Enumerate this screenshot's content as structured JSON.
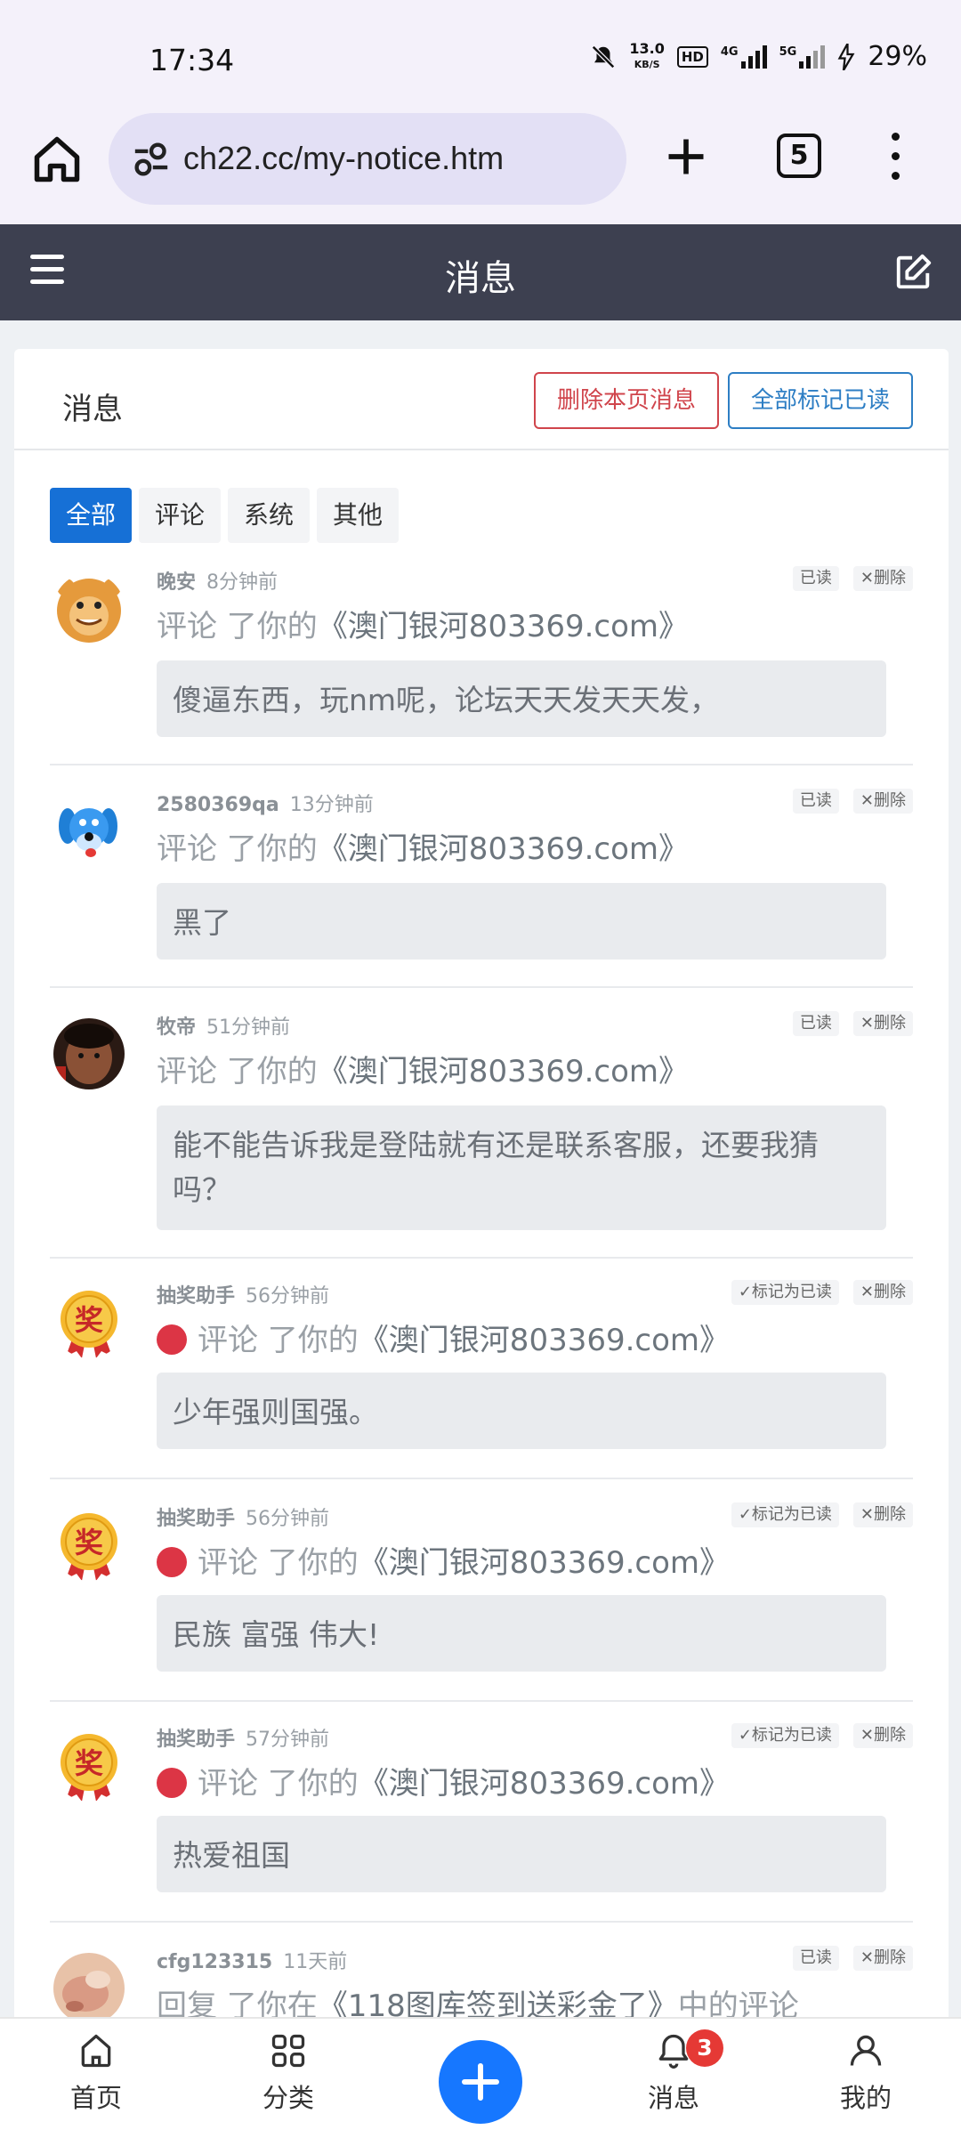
{
  "status_bar": {
    "time": "17:34",
    "net_speed_value": "13.0",
    "net_speed_unit": "KB/S",
    "hd": "HD",
    "sim1": "4G",
    "sim2": "5G",
    "battery": "29%"
  },
  "browser": {
    "url": "ch22.cc/my-notice.htm",
    "tab_count": "5"
  },
  "header": {
    "title": "消息"
  },
  "card": {
    "title": "消息",
    "delete_page_label": "删除本页消息",
    "mark_all_label": "全部标记已读"
  },
  "filters": [
    {
      "label": "全部",
      "active": true
    },
    {
      "label": "评论",
      "active": false
    },
    {
      "label": "系统",
      "active": false
    },
    {
      "label": "其他",
      "active": false
    }
  ],
  "notices": [
    {
      "username": "晚安",
      "time": "8分钟前",
      "read_label": "已读",
      "delete_label": "✕删除",
      "unread": false,
      "action": "评论 了你的",
      "link": "《澳门银河803369.com》",
      "quote": "傻逼东西，玩nm呢，论坛天天发天天发，",
      "avatar": "lion"
    },
    {
      "username": "2580369qa",
      "time": "13分钟前",
      "read_label": "已读",
      "delete_label": "✕删除",
      "unread": false,
      "action": "评论 了你的",
      "link": "《澳门银河803369.com》",
      "quote": "黑了",
      "avatar": "dog"
    },
    {
      "username": "牧帝",
      "time": "51分钟前",
      "read_label": "已读",
      "delete_label": "✕删除",
      "unread": false,
      "action": "评论 了你的",
      "link": "《澳门银河803369.com》",
      "quote": "能不能告诉我是登陆就有还是联系客服，还要我猜吗？",
      "avatar": "photo"
    },
    {
      "username": "抽奖助手",
      "time": "56分钟前",
      "read_label": "✓标记为已读",
      "delete_label": "✕删除",
      "unread": true,
      "action": "评论 了你的",
      "link": "《澳门银河803369.com》",
      "quote": "少年强则国强。",
      "avatar": "medal"
    },
    {
      "username": "抽奖助手",
      "time": "56分钟前",
      "read_label": "✓标记为已读",
      "delete_label": "✕删除",
      "unread": true,
      "action": "评论 了你的",
      "link": "《澳门银河803369.com》",
      "quote": "民族 富强 伟大!",
      "avatar": "medal"
    },
    {
      "username": "抽奖助手",
      "time": "57分钟前",
      "read_label": "✓标记为已读",
      "delete_label": "✕删除",
      "unread": true,
      "action": "评论 了你的",
      "link": "《澳门银河803369.com》",
      "quote": "热爱祖国",
      "avatar": "medal"
    },
    {
      "username": "cfg123315",
      "time": "11天前",
      "read_label": "已读",
      "delete_label": "✕删除",
      "unread": false,
      "action": "回复 了你在",
      "link": "《118图库签到送彩金了》",
      "tail": "中的评论",
      "avatar": "skin"
    }
  ],
  "avatar_text": {
    "medal": "奖"
  },
  "bottom_nav": {
    "home": "首页",
    "category": "分类",
    "messages": "消息",
    "messages_badge": "3",
    "mine": "我的"
  }
}
